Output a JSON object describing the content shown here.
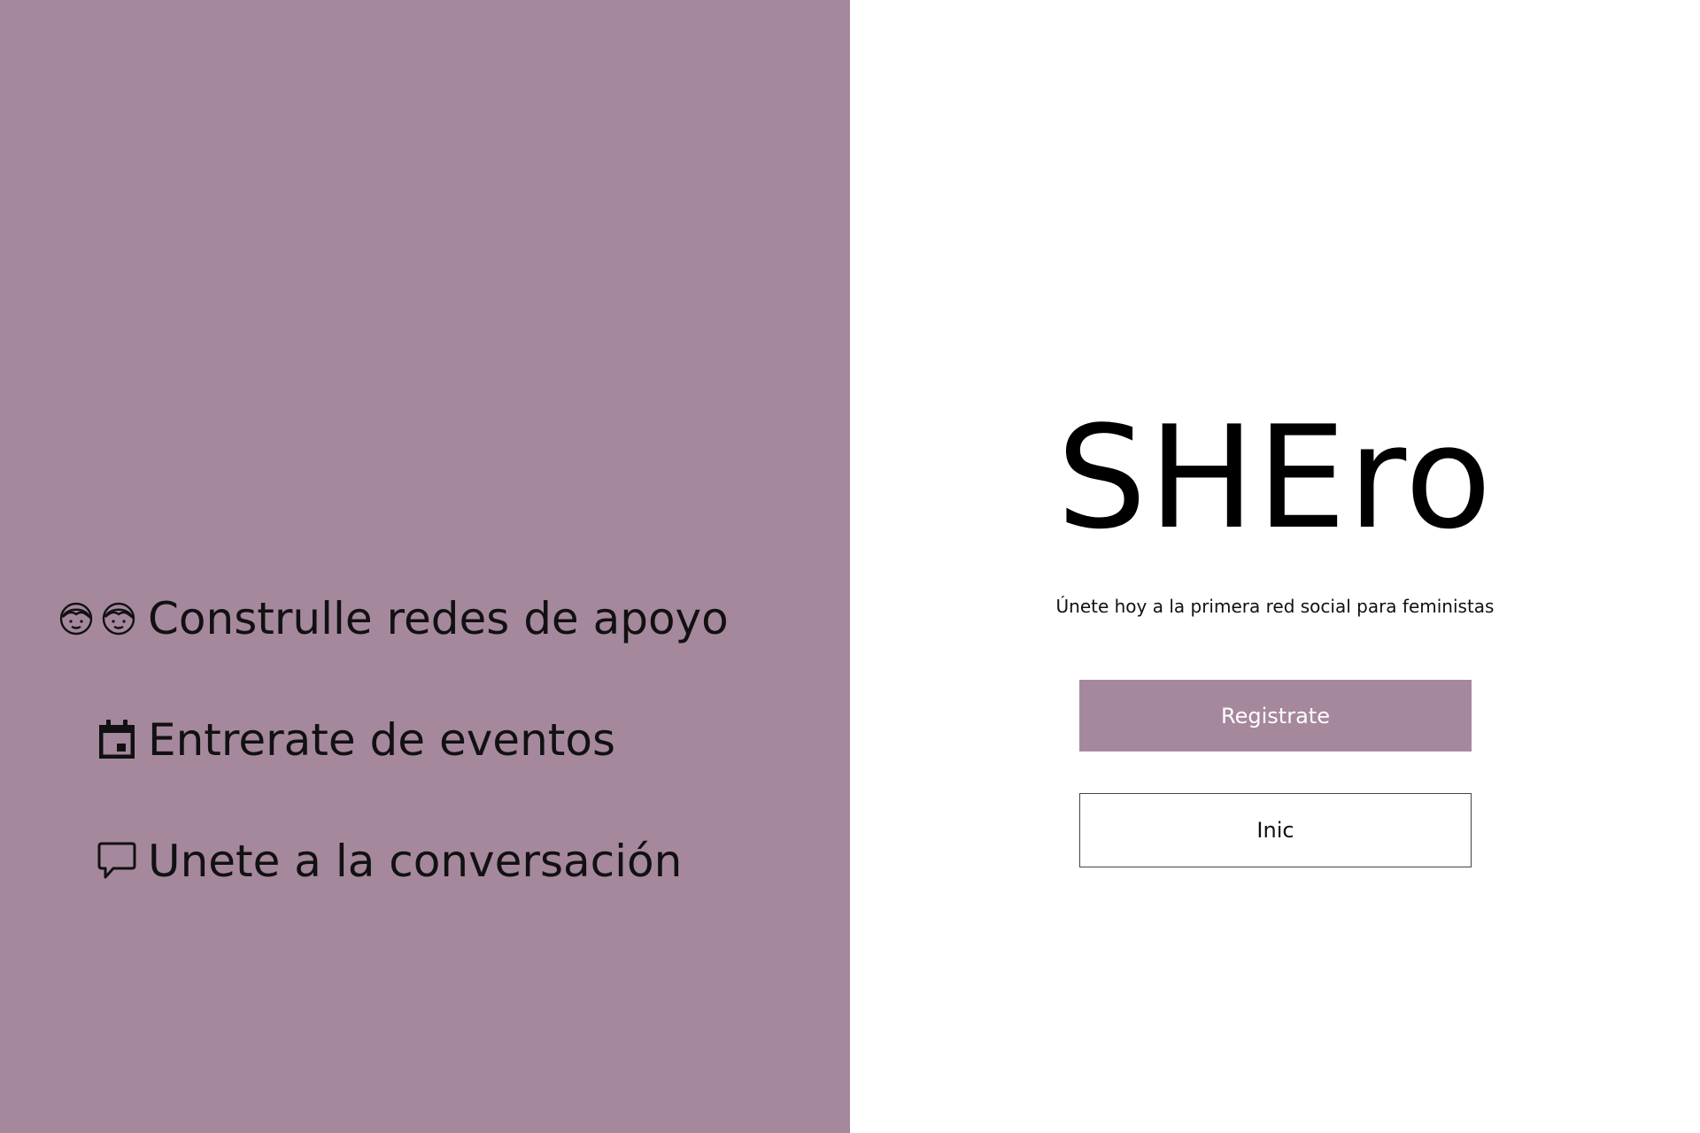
{
  "colors": {
    "accent": "#a6889d",
    "text_dark": "#111111",
    "background": "#ffffff"
  },
  "features": [
    {
      "icons": [
        "face-icon",
        "face-icon"
      ],
      "label": "Construlle redes de apoyo"
    },
    {
      "icons": [
        "calendar-event-icon"
      ],
      "label": "Entrerate de eventos"
    },
    {
      "icons": [
        "chat-bubble-icon"
      ],
      "label": "Unete a la conversación"
    }
  ],
  "brand": {
    "name": "SHEro",
    "tagline": "Únete hoy a la primera red social para feministas"
  },
  "actions": {
    "register_label": "Registrate",
    "login_label": "Inic"
  }
}
